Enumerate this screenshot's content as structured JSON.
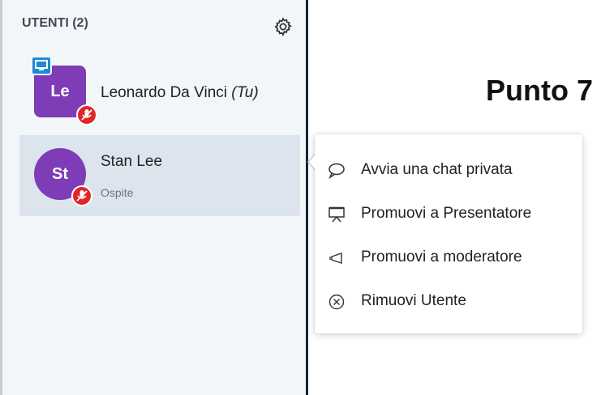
{
  "users_panel": {
    "header": "UTENTI (2)",
    "users": [
      {
        "initials": "Le",
        "name": "Leonardo Da Vinci",
        "you_tag": "(Tu)",
        "role": "",
        "avatar_color": "#7e3cb6",
        "shape": "square",
        "is_presenter": true,
        "muted": true
      },
      {
        "initials": "St",
        "name": "Stan Lee",
        "role": "Ospite",
        "avatar_color": "#7e3cb6",
        "shape": "circle",
        "is_presenter": false,
        "muted": true,
        "selected": true
      }
    ]
  },
  "presentation": {
    "title": "Punto 7"
  },
  "context_menu": {
    "items": [
      {
        "label": "Avvia una chat privata",
        "icon": "chat-bubble-icon"
      },
      {
        "label": "Promuovi a Presentatore",
        "icon": "presentation-board-icon"
      },
      {
        "label": "Promuovi a moderatore",
        "icon": "megaphone-icon"
      },
      {
        "label": "Rimuovi Utente",
        "icon": "circle-x-icon"
      }
    ]
  },
  "colors": {
    "accent": "#7e3cb6",
    "mute": "#e0262a",
    "presenter": "#1e8ad6",
    "selection": "#dce4ee"
  }
}
